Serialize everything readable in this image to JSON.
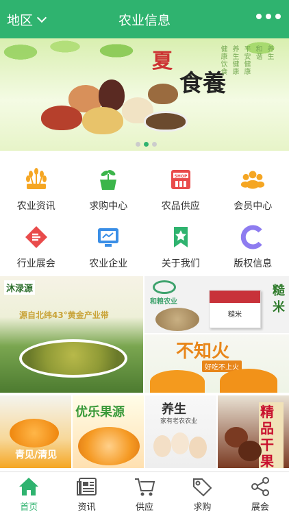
{
  "header": {
    "region_label": "地区",
    "title": "农业信息"
  },
  "banner": {
    "headline_1": "夏",
    "headline_2": "食養",
    "carousel_dots": 3,
    "active_dot": 2
  },
  "menu": {
    "items": [
      {
        "label": "农业资讯",
        "icon": "wheat-icon"
      },
      {
        "label": "求购中心",
        "icon": "sprout-basket-icon"
      },
      {
        "label": "农品供应",
        "icon": "shop-icon"
      },
      {
        "label": "会员中心",
        "icon": "members-icon"
      },
      {
        "label": "行业展会",
        "icon": "exhibition-icon"
      },
      {
        "label": "农业企业",
        "icon": "enterprise-icon"
      },
      {
        "label": "关于我们",
        "icon": "ribbon-star-icon"
      },
      {
        "label": "版权信息",
        "icon": "copyright-c-icon"
      }
    ]
  },
  "products": {
    "tile_1": {
      "brand": "沐渌源",
      "slogan": "源自北纬43°黄金产业带"
    },
    "tile_2": {
      "brand": "和粮农业",
      "tag": "糙米",
      "box_text": "糙米"
    },
    "tile_3": {
      "headline": "不知火",
      "sub": "好吃不上火"
    },
    "tile_4": {
      "headline": "青见/清见"
    },
    "tile_5": {
      "headline": "优乐果源"
    },
    "tile_6": {
      "headline": "养生",
      "sub": "家有老农农业"
    },
    "tile_7": {
      "headline": "精品干果"
    }
  },
  "tabbar": {
    "tabs": [
      {
        "label": "首页",
        "icon": "home-icon",
        "active": true
      },
      {
        "label": "资讯",
        "icon": "news-icon",
        "active": false
      },
      {
        "label": "供应",
        "icon": "cart-icon",
        "active": false
      },
      {
        "label": "求购",
        "icon": "tag-icon",
        "active": false
      },
      {
        "label": "展会",
        "icon": "share-icon",
        "active": false
      }
    ]
  },
  "colors": {
    "brand_green": "#2fb36f",
    "icon_orange": "#f5a623",
    "icon_red": "#e94b4b",
    "icon_blue": "#3a8ee6",
    "icon_purple": "#8e7cf0"
  }
}
